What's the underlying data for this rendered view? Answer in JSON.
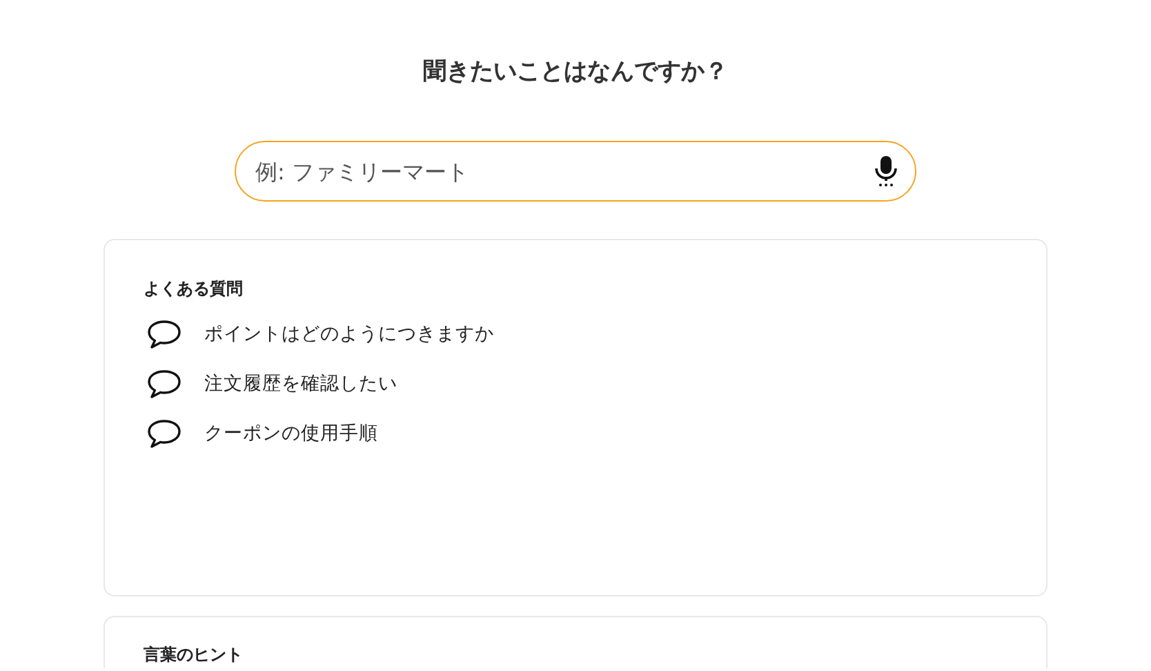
{
  "title": "聞きたいことはなんですか？",
  "search": {
    "placeholder": "例: ファミリーマート"
  },
  "faq": {
    "heading": "よくある質問",
    "items": [
      {
        "text": "ポイントはどのようにつきますか"
      },
      {
        "text": "注文履歴を確認したい"
      },
      {
        "text": "クーポンの使用手順"
      }
    ]
  },
  "hints": {
    "heading": "言葉のヒント"
  }
}
